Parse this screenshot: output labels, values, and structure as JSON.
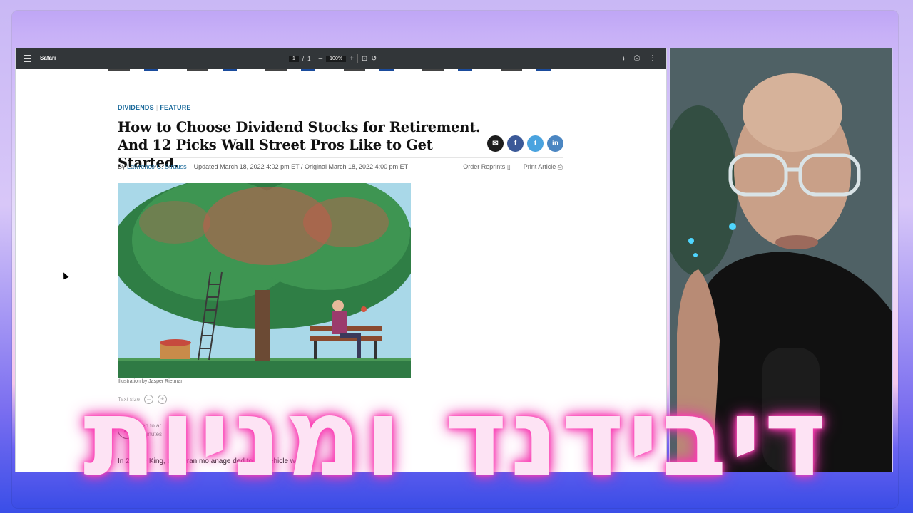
{
  "toolbar": {
    "title": "Safari",
    "page_current": "1",
    "page_sep": "/",
    "page_total": "1",
    "zoom": "100%",
    "zoom_out": "–",
    "zoom_in": "+"
  },
  "article": {
    "tag1": "DIVIDENDS",
    "tag_sep": "|",
    "tag2": "FEATURE",
    "headline_line1": "How to Choose Dividend Stocks for Retirement.",
    "headline_line2": "And 12 Picks Wall Street Pros Like to Get Started.",
    "by_prefix": "By",
    "author": "Lawrence C. Strauss",
    "dates": "Updated March 18, 2022 4:02 pm ET / Original March 18, 2022 4:00 pm ET",
    "order_reprints": "Order Reprints",
    "print_article": "Print Article",
    "caption": "Illustration by Jasper Rietman",
    "text_size_label": "Text size",
    "text_size_minus": "–",
    "text_size_plus": "+",
    "audio_line1": "en to ar",
    "audio_line2": "minutes",
    "paragraph": "In 20     ave King, a veteran mo      anage    ded to set      vehicle      would"
  },
  "share": {
    "email": "✉",
    "facebook": "f",
    "twitter": "t",
    "linkedin": "in"
  },
  "overlay": {
    "text": "דיבידנד ומניות"
  },
  "colors": {
    "accent_link": "#1b6a9b",
    "toolbar_bg": "#323639",
    "overlay_glow": "#ff3fb6",
    "facebook": "#3b5998",
    "twitter": "#4aa3df",
    "linkedin": "#4b86c2"
  }
}
